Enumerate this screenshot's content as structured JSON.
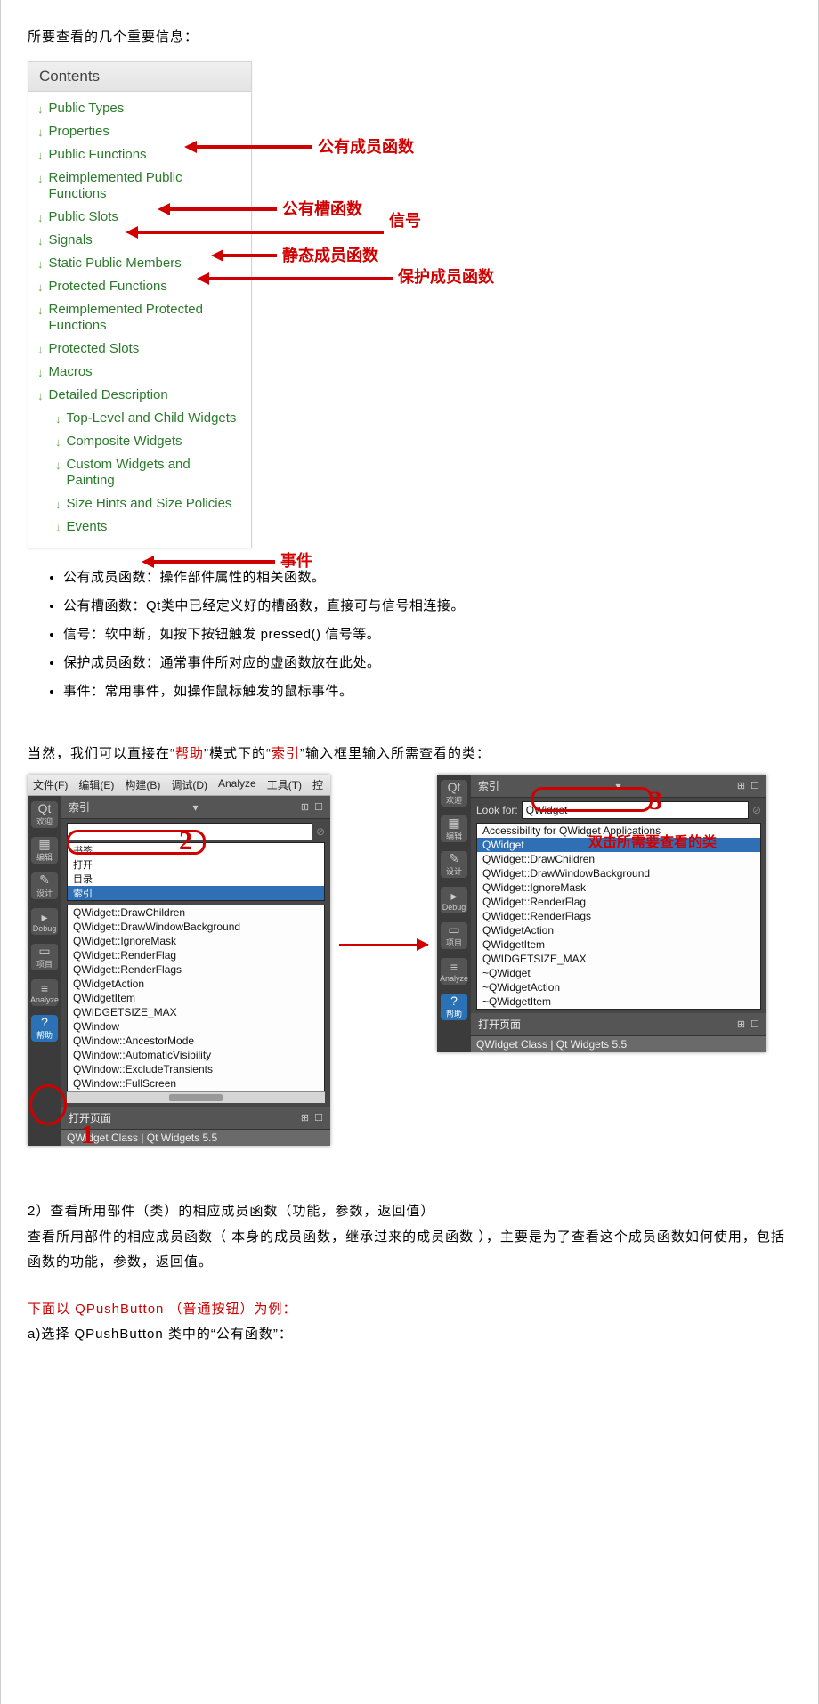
{
  "intro": "所要查看的几个重要信息：",
  "contents": {
    "header": "Contents",
    "items": [
      {
        "label": "Public Types",
        "indent": false
      },
      {
        "label": "Properties",
        "indent": false
      },
      {
        "label": "Public Functions",
        "indent": false
      },
      {
        "label": "Reimplemented Public Functions",
        "indent": false
      },
      {
        "label": "Public Slots",
        "indent": false
      },
      {
        "label": "Signals",
        "indent": false
      },
      {
        "label": "Static Public Members",
        "indent": false
      },
      {
        "label": "Protected Functions",
        "indent": false
      },
      {
        "label": "Reimplemented Protected Functions",
        "indent": false
      },
      {
        "label": "Protected Slots",
        "indent": false
      },
      {
        "label": "Macros",
        "indent": false
      },
      {
        "label": "Detailed Description",
        "indent": false
      },
      {
        "label": "Top-Level and Child Widgets",
        "indent": true
      },
      {
        "label": "Composite Widgets",
        "indent": true
      },
      {
        "label": "Custom Widgets and Painting",
        "indent": true
      },
      {
        "label": "Size Hints and Size Policies",
        "indent": true
      },
      {
        "label": "Events",
        "indent": true
      }
    ]
  },
  "annotations": {
    "a1": "公有成员函数",
    "a2": "公有槽函数",
    "a3": "信号",
    "a4": "静态成员函数",
    "a5": "保护成员函数",
    "a6": "事件"
  },
  "desc_list": [
    "公有成员函数：操作部件属性的相关函数。",
    "公有槽函数：Qt类中已经定义好的槽函数，直接可与信号相连接。",
    "信号：软中断，如按下按钮触发 pressed() 信号等。",
    "保护成员函数：通常事件所对应的虚函数放在此处。",
    "事件：常用事件，如操作鼠标触发的鼠标事件。"
  ],
  "middle_para": {
    "p1a": "当然，我们可以直接在“",
    "p1b": "帮助",
    "p1c": "”模式下的“",
    "p1d": "索引",
    "p1e": "”输入框里输入所需查看的类："
  },
  "qt_left": {
    "menubar": [
      "文件(F)",
      "编辑(E)",
      "构建(B)",
      "调试(D)",
      "Analyze",
      "工具(T)",
      "控"
    ],
    "panel_title": "索引",
    "sidebar": [
      {
        "ico": "Qt",
        "label": "欢迎"
      },
      {
        "ico": "▦",
        "label": "编辑"
      },
      {
        "ico": "✎",
        "label": "设计"
      },
      {
        "ico": "▸",
        "label": "Debug"
      },
      {
        "ico": "▭",
        "label": "项目"
      },
      {
        "ico": "≡",
        "label": "Analyze"
      },
      {
        "ico": "?",
        "label": "帮助"
      }
    ],
    "search_dropdown": [
      "书签",
      "打开",
      "目录",
      "索引"
    ],
    "list": [
      "QWidget::DrawChildren",
      "QWidget::DrawWindowBackground",
      "QWidget::IgnoreMask",
      "QWidget::RenderFlag",
      "QWidget::RenderFlags",
      "QWidgetAction",
      "QWidgetItem",
      "QWIDGETSIZE_MAX",
      "QWindow",
      "QWindow::AncestorMode",
      "QWindow::AutomaticVisibility",
      "QWindow::ExcludeTransients",
      "QWindow::FullScreen"
    ],
    "open_label": "打开页面",
    "open_value": "QWidget Class | Qt Widgets 5.5"
  },
  "qt_right": {
    "panel_title": "索引",
    "lookfor_label": "Look for:",
    "lookfor_value": "QWidget",
    "list_top": "Accessibility for QWidget Applications",
    "list_sel": "QWidget",
    "list": [
      "QWidget::DrawChildren",
      "QWidget::DrawWindowBackground",
      "QWidget::IgnoreMask",
      "QWidget::RenderFlag",
      "QWidget::RenderFlags",
      "QWidgetAction",
      "QWidgetItem",
      "QWIDGETSIZE_MAX",
      "~QWidget",
      "~QWidgetAction",
      "~QWidgetItem"
    ],
    "open_label": "打开页面",
    "open_value": "QWidget Class | Qt Widgets 5.5",
    "dbl_click_note": "双击所需要查看的类"
  },
  "nums": {
    "n1": "1",
    "n2": "2",
    "n3": "3"
  },
  "section2": {
    "h": "2）查看所用部件（类）的相应成员函数（功能，参数，返回值）",
    "p": "查看所用部件的相应成员函数（ 本身的成员函数，继承过来的成员函数 ），主要是为了查看这个成员函数如何使用，包括函数的功能，参数，返回值。",
    "red_line": "下面以 QPushButton （普通按钮）为例：",
    "last": "a)选择 QPushButton 类中的“公有函数”："
  }
}
